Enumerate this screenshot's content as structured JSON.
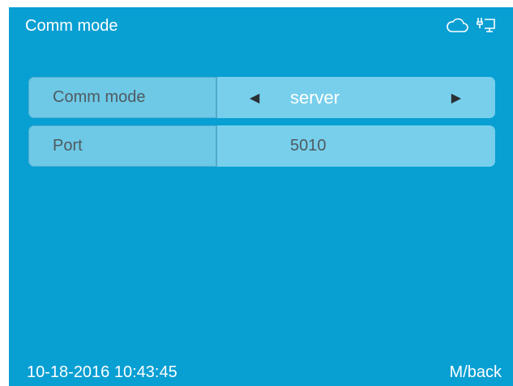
{
  "header": {
    "title": "Comm mode",
    "icons": [
      "cloud-icon",
      "ethernet-plug-icon"
    ]
  },
  "settings": [
    {
      "label": "Comm mode",
      "value": "server",
      "has_arrows": true
    },
    {
      "label": "Port",
      "value": "5010",
      "has_arrows": false
    }
  ],
  "footer": {
    "datetime": "10-18-2016 10:43:45",
    "back_label": "M/back"
  },
  "colors": {
    "background": "#089fd3",
    "label_cell": "#6ec9e6",
    "value_cell": "#77cfeb",
    "text_dark": "#505a60"
  }
}
